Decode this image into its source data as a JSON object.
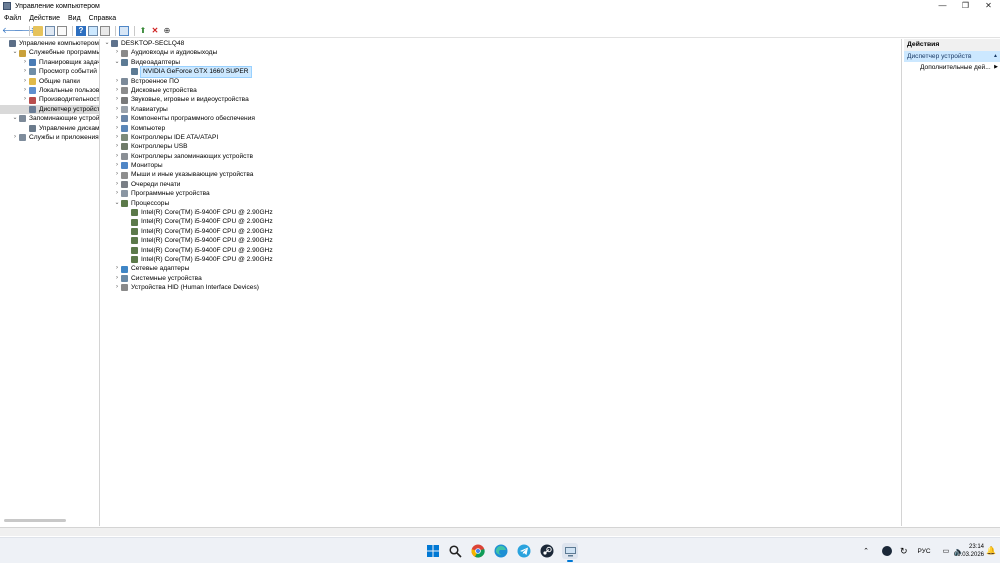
{
  "window": {
    "title": "Управление компьютером",
    "minimize": "—",
    "maximize": "❐",
    "close": "✕"
  },
  "menu": [
    "Файл",
    "Действие",
    "Вид",
    "Справка"
  ],
  "left_tree": [
    {
      "label": "Управление компьютером (л",
      "level": 0,
      "toggle": "",
      "color": "#5b6e87"
    },
    {
      "label": "Служебные программы",
      "level": 1,
      "toggle": "⌄",
      "color": "#c9a13b"
    },
    {
      "label": "Планировщик задач",
      "level": 2,
      "toggle": "›",
      "color": "#4a7cb5"
    },
    {
      "label": "Просмотр событий",
      "level": 2,
      "toggle": "›",
      "color": "#6f8da6"
    },
    {
      "label": "Общие папки",
      "level": 2,
      "toggle": "›",
      "color": "#e0b94a"
    },
    {
      "label": "Локальные пользоват",
      "level": 2,
      "toggle": "›",
      "color": "#5e8fcf"
    },
    {
      "label": "Производительность",
      "level": 2,
      "toggle": "›",
      "color": "#b84d4d"
    },
    {
      "label": "Диспетчер устройств",
      "level": 2,
      "toggle": "",
      "color": "#6a7d96",
      "selected": true
    },
    {
      "label": "Запоминающие устройст",
      "level": 1,
      "toggle": "⌄",
      "color": "#7d8a99"
    },
    {
      "label": "Управление дисками",
      "level": 2,
      "toggle": "",
      "color": "#6b7b8c"
    },
    {
      "label": "Службы и приложения",
      "level": 1,
      "toggle": "›",
      "color": "#7e8c9c"
    }
  ],
  "device_tree": [
    {
      "label": "DESKTOP-SECLQ48",
      "level": 0,
      "toggle": "⌄",
      "color": "#5e728c"
    },
    {
      "label": "Аудиовходы и аудиовыходы",
      "level": 1,
      "toggle": "›",
      "color": "#8a8a8a"
    },
    {
      "label": "Видеоадаптеры",
      "level": 1,
      "toggle": "⌄",
      "color": "#5d7b94"
    },
    {
      "label": "NVIDIA GeForce GTX 1660 SUPER",
      "level": 2,
      "toggle": "",
      "color": "#5d7b94",
      "selected": true
    },
    {
      "label": "Встроенное ПО",
      "level": 1,
      "toggle": "›",
      "color": "#7c8a99"
    },
    {
      "label": "Дисковые устройства",
      "level": 1,
      "toggle": "›",
      "color": "#8b8b8b"
    },
    {
      "label": "Звуковые, игровые и видеоустройства",
      "level": 1,
      "toggle": "›",
      "color": "#7a7a7a"
    },
    {
      "label": "Клавиатуры",
      "level": 1,
      "toggle": "›",
      "color": "#9aa2ab"
    },
    {
      "label": "Компоненты программного обеспечения",
      "level": 1,
      "toggle": "›",
      "color": "#6a86a8"
    },
    {
      "label": "Компьютер",
      "level": 1,
      "toggle": "›",
      "color": "#5b87b8"
    },
    {
      "label": "Контроллеры IDE ATA/ATAPI",
      "level": 1,
      "toggle": "›",
      "color": "#7d8b7a"
    },
    {
      "label": "Контроллеры USB",
      "level": 1,
      "toggle": "›",
      "color": "#6f7b69"
    },
    {
      "label": "Контроллеры запоминающих устройств",
      "level": 1,
      "toggle": "›",
      "color": "#8a8f95"
    },
    {
      "label": "Мониторы",
      "level": 1,
      "toggle": "›",
      "color": "#4f86c6"
    },
    {
      "label": "Мыши и иные указывающие устройства",
      "level": 1,
      "toggle": "›",
      "color": "#8e8e8e"
    },
    {
      "label": "Очереди печати",
      "level": 1,
      "toggle": "›",
      "color": "#7a7f86"
    },
    {
      "label": "Программные устройства",
      "level": 1,
      "toggle": "›",
      "color": "#8a96a3"
    },
    {
      "label": "Процессоры",
      "level": 1,
      "toggle": "⌄",
      "color": "#5c7a4a"
    },
    {
      "label": "Intel(R) Core(TM) i5-9400F CPU @ 2.90GHz",
      "level": 2,
      "toggle": "",
      "color": "#5c7a4a"
    },
    {
      "label": "Intel(R) Core(TM) i5-9400F CPU @ 2.90GHz",
      "level": 2,
      "toggle": "",
      "color": "#5c7a4a"
    },
    {
      "label": "Intel(R) Core(TM) i5-9400F CPU @ 2.90GHz",
      "level": 2,
      "toggle": "",
      "color": "#5c7a4a"
    },
    {
      "label": "Intel(R) Core(TM) i5-9400F CPU @ 2.90GHz",
      "level": 2,
      "toggle": "",
      "color": "#5c7a4a"
    },
    {
      "label": "Intel(R) Core(TM) i5-9400F CPU @ 2.90GHz",
      "level": 2,
      "toggle": "",
      "color": "#5c7a4a"
    },
    {
      "label": "Intel(R) Core(TM) i5-9400F CPU @ 2.90GHz",
      "level": 2,
      "toggle": "",
      "color": "#5c7a4a"
    },
    {
      "label": "Сетевые адаптеры",
      "level": 1,
      "toggle": "›",
      "color": "#3f86c6"
    },
    {
      "label": "Системные устройства",
      "level": 1,
      "toggle": "›",
      "color": "#6a8aa6"
    },
    {
      "label": "Устройства HID (Human Interface Devices)",
      "level": 1,
      "toggle": "›",
      "color": "#8a8a8a"
    }
  ],
  "actions": {
    "header": "Действия",
    "section": "Диспетчер устройств",
    "section_arrow": "▲",
    "more": "Дополнительные дей...",
    "more_arrow": "▶"
  },
  "taskbar": {
    "lang": "РУС",
    "time": "23:14",
    "date": "09.03.2026"
  },
  "colors": {
    "selection": "#cce8ff",
    "accent": "#0078d4"
  }
}
